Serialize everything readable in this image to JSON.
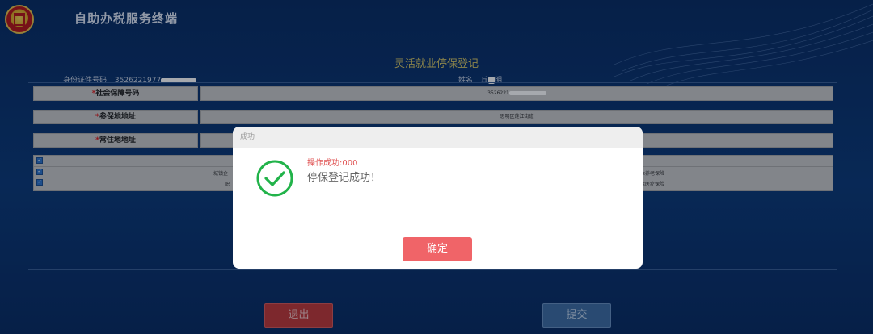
{
  "header": {
    "app_title": "自助办税服务终端"
  },
  "form": {
    "title": "灵活就业停保登记",
    "id_label": "身份证件号码:",
    "id_value": "3526221977",
    "name_label": "姓名:",
    "name_first": "丘",
    "name_last": "明",
    "fields": [
      {
        "label": "社会保障号码",
        "value": "3526221"
      },
      {
        "label": "参保地地址",
        "value": "思明区莲江街道"
      },
      {
        "label": "常住地地址",
        "value": ""
      }
    ],
    "table": {
      "rows": [
        {
          "checked": true,
          "left_text": "",
          "right_text": ""
        },
        {
          "checked": true,
          "left_text": "城镇企",
          "right_text": "本养老保险"
        },
        {
          "checked": true,
          "left_text": "职",
          "right_text": "本医疗保险"
        }
      ]
    }
  },
  "buttons": {
    "exit_label": "退出",
    "submit_label": "提交"
  },
  "dialog": {
    "title": "成功",
    "code_text": "操作成功:000",
    "message": "停保登记成功！",
    "confirm_label": "确定"
  },
  "colors": {
    "background": "#0b3370",
    "success_green": "#22b34a",
    "confirm_button": "#f06468",
    "exit_button": "#c03a3a",
    "submit_button": "#3f6ea3",
    "title_gold": "#d7c766"
  },
  "icons": {
    "emblem": "tax-emblem-icon",
    "success": "check-circle-icon",
    "checkbox": "checkbox-checked-icon"
  }
}
